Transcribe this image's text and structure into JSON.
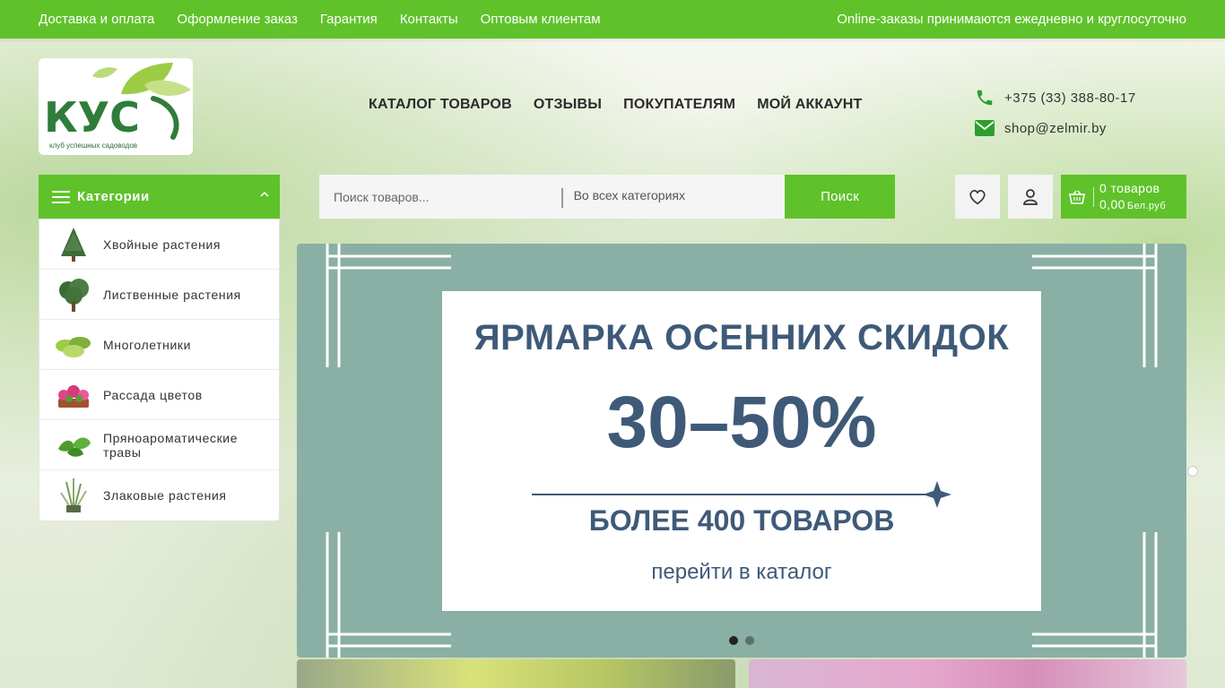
{
  "topbar": {
    "links": [
      "Доставка и оплата",
      "Оформление заказ",
      "Гарантия",
      "Контакты",
      "Оптовым клиентам"
    ],
    "notice": "Online-заказы принимаются ежедневно и круглосуточно"
  },
  "logo": {
    "text": "КУС",
    "caption": "клуб успешных садоводов"
  },
  "main_nav": [
    "КАТАЛОГ ТОВАРОВ",
    "ОТЗЫВЫ",
    "ПОКУПАТЕЛЯМ",
    "МОЙ АККАУНТ"
  ],
  "contacts": {
    "phone": "+375 (33) 388-80-17",
    "email": "shop@zelmir.by",
    "phone_icon": "phone-icon",
    "email_icon": "envelope-icon"
  },
  "categories": {
    "title": "Категории",
    "items": [
      {
        "label": "Хвойные растения",
        "icon": "conifer-thumb"
      },
      {
        "label": "Лиственные растения",
        "icon": "tree-thumb"
      },
      {
        "label": "Многолетники",
        "icon": "hosta-thumb"
      },
      {
        "label": "Рассада цветов",
        "icon": "flower-thumb"
      },
      {
        "label": "Пряноароматические травы",
        "icon": "herb-thumb"
      },
      {
        "label": "Злаковые растения",
        "icon": "grass-thumb"
      }
    ]
  },
  "search": {
    "placeholder": "Поиск товаров...",
    "category": "Во всех категориях",
    "button": "Поиск"
  },
  "cart": {
    "count": "0 товаров",
    "total": "0,00",
    "currency": "Бел.руб"
  },
  "banner": {
    "title": "ЯРМАРКА ОСЕННИХ СКИДОК",
    "discount": "30–50%",
    "subtitle": "БОЛЕЕ 400 ТОВАРОВ",
    "cta": "перейти в каталог",
    "slides": 2,
    "active_slide": 1
  },
  "colors": {
    "accent": "#5fc22a",
    "banner_bg": "#8aafa4",
    "banner_text": "#3f5a78"
  }
}
